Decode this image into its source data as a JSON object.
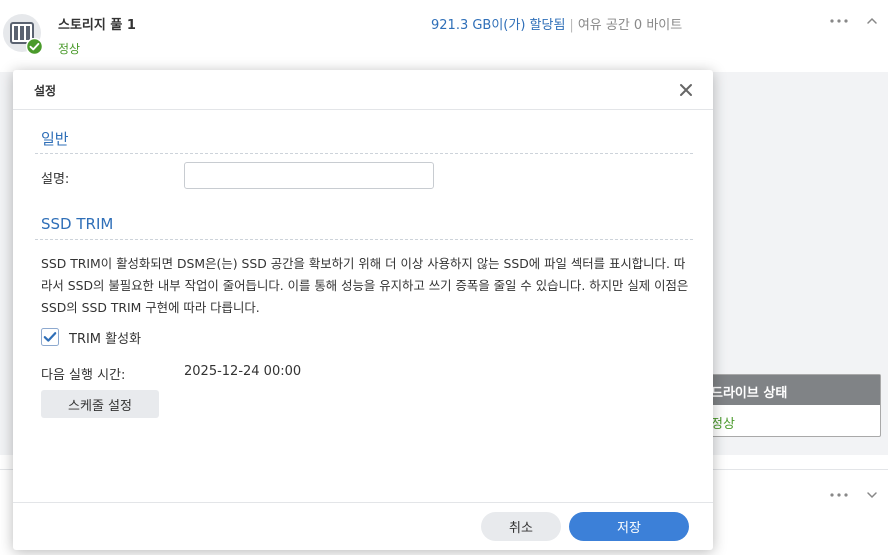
{
  "pool": {
    "name": "스토리지 풀 1",
    "status": "정상",
    "allocated": "921.3 GB이(가) 할당됨",
    "separator": "|",
    "free_space": "여유 공간 0 바이트"
  },
  "drive_status": {
    "header": "드라이브 상태",
    "value": "정상"
  },
  "dialog": {
    "title": "설정",
    "general": {
      "section_title": "일반",
      "description_label": "설명:",
      "description_value": ""
    },
    "ssd_trim": {
      "section_title": "SSD TRIM",
      "description": "SSD TRIM이 활성화되면 DSM은(는) SSD 공간을 확보하기 위해 더 이상 사용하지 않는 SSD에 파일 섹터를 표시합니다. 따라서 SSD의 불필요한 내부 작업이 줄어듭니다. 이를 통해 성능을 유지하고 쓰기 증폭을 줄일 수 있습니다. 하지만 실제 이점은 SSD의 SSD TRIM 구현에 따라 다릅니다.",
      "enable_label": "TRIM 활성화",
      "enabled": true,
      "next_run_label": "다음 실행 시간:",
      "next_run_value": "2025-12-24 00:00",
      "schedule_button": "스케줄 설정"
    },
    "cancel_button": "취소",
    "save_button": "저장"
  },
  "colors": {
    "accent": "#3c80d8",
    "section_title": "#2f6fb8",
    "status_ok": "#4a9a2b",
    "drive_header_bg": "#808386"
  },
  "icons": [
    "storage-pool-icon",
    "status-ok-check-icon",
    "more-icon",
    "chevron-up-icon",
    "chevron-down-icon",
    "close-icon",
    "checkbox-checked-icon"
  ]
}
